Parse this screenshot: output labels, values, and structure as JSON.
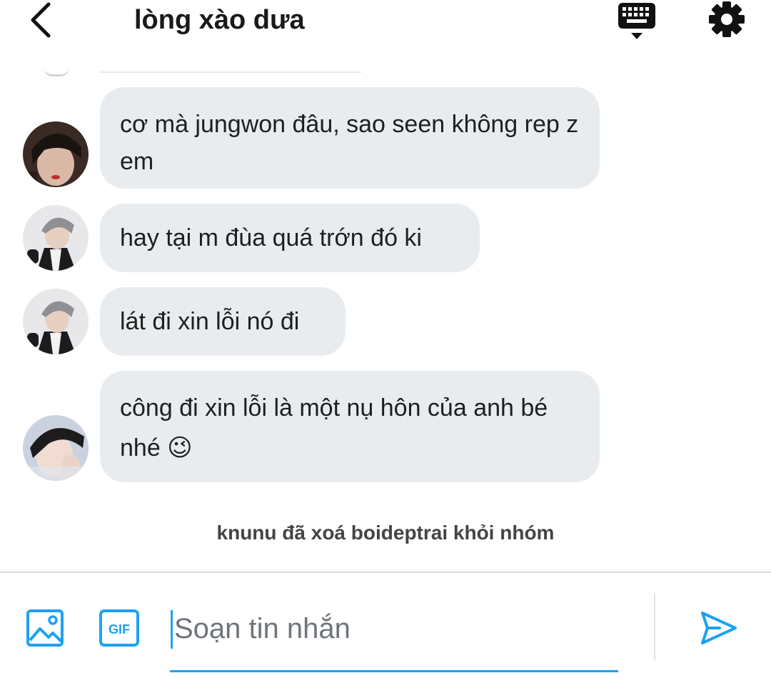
{
  "header": {
    "title": "lòng xào dưa",
    "back_icon": "chevron-left-icon",
    "keyboard_icon": "keyboard-icon",
    "settings_icon": "gear-icon"
  },
  "messages": [
    {
      "text": "cơ mà jungwon đâu, sao seen không rep z em",
      "avatar": "avatar-dark-hair-red-lips"
    },
    {
      "text": "hay tại m đùa quá trớn đó ki",
      "avatar": "avatar-silver-hair"
    },
    {
      "text": "lát đi xin lỗi nó đi",
      "avatar": "avatar-silver-hair"
    },
    {
      "text": "công đi xin lỗi là một nụ hôn của anh bé nhé 😉",
      "avatar": "avatar-dark-hair-hand"
    }
  ],
  "system_notice": "knunu đã xoá boideptrai khỏi nhóm",
  "composer": {
    "placeholder": "Soạn tin nhắn",
    "value": "",
    "image_icon": "image-icon",
    "gif_label": "GIF",
    "send_icon": "send-icon"
  },
  "colors": {
    "accent": "#1da1f2",
    "bubble": "#e9ecef",
    "text": "#1f1f1f",
    "notice": "#444444"
  }
}
